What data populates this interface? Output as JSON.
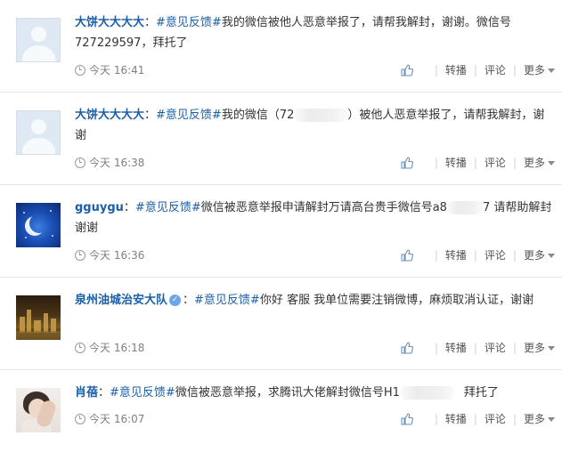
{
  "posts": [
    {
      "nickname": "大饼大大大大",
      "colon": "：",
      "topic": "#意见反馈#",
      "text_before": "我的微信被他人恶意举报了，请帮我解封，谢谢。微信号727229597，拜托了",
      "text_after": "",
      "time": "今天 16:41",
      "avatar_type": "default-avatar"
    },
    {
      "nickname": "大饼大大大大",
      "colon": "：",
      "topic": "#意见反馈#",
      "text_before": "我的微信（72",
      "text_after": "）被他人恶意举报了，请帮我解封，谢谢",
      "time": "今天 16:38",
      "avatar_type": "default-avatar"
    },
    {
      "nickname": "gguygu",
      "colon": "：",
      "topic": "#意见反馈#",
      "text_before": "微信被恶意举报申请解封万请高台贵手微信号a8",
      "text_after": "7 请帮助解封谢谢",
      "time": "今天 16:36",
      "avatar_type": "moon-avatar"
    },
    {
      "nickname": "泉州油城治安大队",
      "colon": "：",
      "topic": "#意见反馈#",
      "text_before": "你好 客服 我单位需要注销微博，麻烦取消认证，谢谢",
      "text_after": "",
      "time": "今天 16:18",
      "avatar_type": "city-avatar",
      "verified": true
    },
    {
      "nickname": "肖蓓",
      "colon": "：",
      "topic": "#意见反馈#",
      "text_before": "微信被恶意举报，求腾讯大佬解封微信号H1",
      "text_after": "拜托了",
      "time": "今天 16:07",
      "avatar_type": "person-avatar"
    }
  ],
  "actions": {
    "repost": "转播",
    "comment": "评论",
    "more": "更多",
    "separator": "|"
  },
  "colors": {
    "link": "#1b5fa8",
    "meta": "#808080",
    "divider": "#e6e6e6"
  }
}
